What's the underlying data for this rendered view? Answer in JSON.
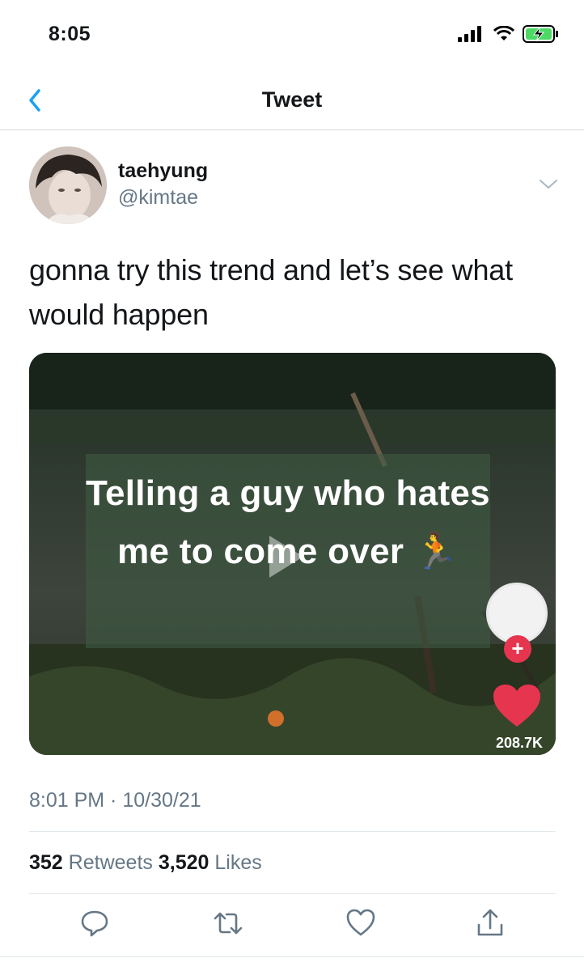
{
  "status_bar": {
    "time": "8:05"
  },
  "nav": {
    "title": "Tweet"
  },
  "author": {
    "name": "taehyung",
    "handle": "@kimtae"
  },
  "tweet": {
    "text": "gonna try this trend and let’s see what would happen"
  },
  "media": {
    "overlay_text": "Telling a guy who hates me to come over 🏃",
    "likes_count": "208.7K"
  },
  "meta": {
    "timestamp": "8:01 PM · 10/30/21"
  },
  "stats": {
    "retweets_count": "352",
    "retweets_label": "Retweets",
    "likes_count": "3,520",
    "likes_label": "Likes"
  },
  "icons": {
    "back": "chevron-left-icon",
    "more": "chevron-down-icon",
    "reply": "reply-icon",
    "retweet": "retweet-icon",
    "like": "heart-icon",
    "share": "share-icon"
  },
  "colors": {
    "accent": "#1da1f2",
    "secondary_text": "#657786",
    "tiktok_red": "#e6354f"
  }
}
